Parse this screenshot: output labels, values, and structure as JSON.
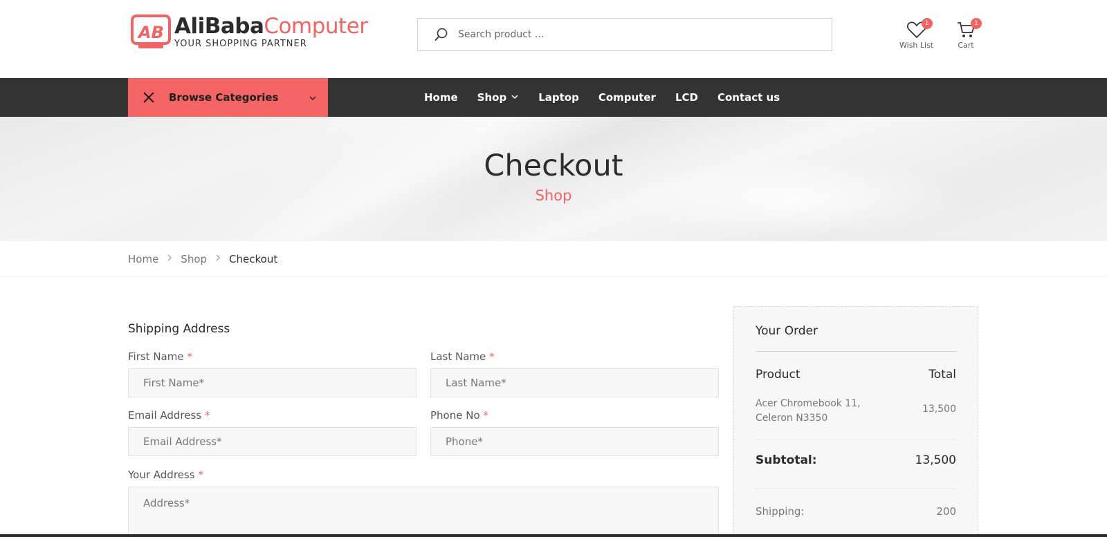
{
  "header": {
    "logo": {
      "brand_dark": "AliBaba",
      "brand_red": "Computer",
      "tagline": "YOUR SHOPPING PARTNER"
    },
    "search": {
      "placeholder": "Search product ..."
    },
    "wishlist": {
      "label": "Wish List",
      "count": "1"
    },
    "cart": {
      "label": "Cart",
      "count": "1"
    }
  },
  "nav": {
    "browse_label": "Browse Categories",
    "links": [
      "Home",
      "Shop",
      "Laptop",
      "Computer",
      "LCD",
      "Contact us"
    ]
  },
  "banner": {
    "title": "Checkout",
    "subtitle": "Shop"
  },
  "breadcrumb": [
    "Home",
    "Shop",
    "Checkout"
  ],
  "form": {
    "section_title": "Shipping Address",
    "required_mark": "*",
    "first_name": {
      "label": "First Name",
      "placeholder": "First Name*"
    },
    "last_name": {
      "label": "Last Name",
      "placeholder": "Last Name*"
    },
    "email": {
      "label": "Email Address",
      "placeholder": "Email Address*"
    },
    "phone": {
      "label": "Phone No",
      "placeholder": "Phone*"
    },
    "address": {
      "label": "Your Address",
      "placeholder": "Address*"
    }
  },
  "order": {
    "title": "Your Order",
    "col_product": "Product",
    "col_total": "Total",
    "item_name": "Acer Chromebook 11, Celeron N3350",
    "item_total": "13,500",
    "subtotal_label": "Subtotal:",
    "subtotal_value": "13,500",
    "shipping_label": "Shipping:",
    "shipping_value": "200"
  },
  "colors": {
    "accent": "#f56565",
    "nav_bg": "#333333"
  }
}
